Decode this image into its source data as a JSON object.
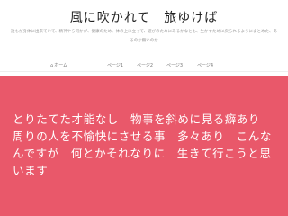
{
  "site": {
    "title": "風に吹かれて　旅ゆけば",
    "description": "誰もが身体に出来ていて、精神やら何かが、健康のため、体の上に立って、遊びのためにあるかなとも、生かすために戻られるようにまとめた、あるのか無いのか"
  },
  "nav": {
    "items": [
      {
        "label": "ホーム",
        "icon": "home-icon"
      },
      {
        "label": "ページ1"
      },
      {
        "label": "ページ2"
      },
      {
        "label": "ページ3"
      },
      {
        "label": "ページ4"
      }
    ]
  },
  "hero": {
    "text": "とりたてた才能なし　物事を斜めに見る癖あり　　周りの人を不愉快にさせる事　多々あり　こんなんですが　何とかそれなりに　生きて行こうと思います",
    "background_color": "#e9586a"
  }
}
